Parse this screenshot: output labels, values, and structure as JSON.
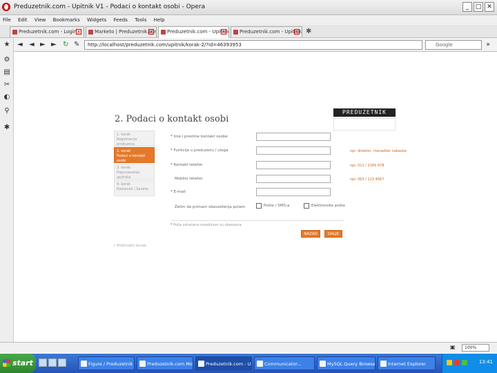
{
  "window": {
    "title": "Preduzetnik.com - Upitnik V1 - Podaci o kontakt osobi - Opera",
    "minimize": "_",
    "maximize": "□",
    "close": "✕"
  },
  "menu": [
    "File",
    "Edit",
    "View",
    "Bookmarks",
    "Widgets",
    "Feeds",
    "Tools",
    "Help"
  ],
  "tabs": [
    {
      "label": "Preduzetnik.com - Login",
      "active": false
    },
    {
      "label": "Marketo | Preduzetnik.com",
      "active": false
    },
    {
      "label": "Preduzetnik.com - Upitnik",
      "active": true
    },
    {
      "label": "Preduzetnik.com - Upitnik",
      "active": false
    }
  ],
  "addressbar": {
    "url": "http://localhost/preduzetnik.com/upitnik/korak-2/?id=46393953",
    "search_placeholder": "Google"
  },
  "page": {
    "heading": "2. Podaci o kontakt osobi",
    "logo": "PREDUZETNIK",
    "steps": [
      {
        "title": "1. korak",
        "subtitle": "Registracija preduzeća",
        "active": false
      },
      {
        "title": "2. korak",
        "subtitle": "Podaci o kontakt osobi",
        "active": true
      },
      {
        "title": "3. korak",
        "subtitle": "Popunjavanje upitnika",
        "active": false
      },
      {
        "title": "4. korak",
        "subtitle": "Nastavak / Savete",
        "active": false
      }
    ],
    "form": {
      "fields": [
        {
          "label": "Ime i prezime kontakt osobe",
          "required": true,
          "hint": ""
        },
        {
          "label": "Funkcija u preduzeću / uloga",
          "required": true,
          "hint": "npr. direktor, menadžer nabavke"
        },
        {
          "label": "Kontakt telefon",
          "required": true,
          "hint": "npr. 011 / 2345 678"
        },
        {
          "label": "Mobilni telefon",
          "required": false,
          "hint": "npr. 063 / 123 4567"
        },
        {
          "label": "E-mail",
          "required": true,
          "hint": ""
        }
      ],
      "contact_pref_label": "Želim da primam obaveštenja putem",
      "checkbox_1": "Pošte / SMS-a",
      "checkbox_2": "Elektronske pošte",
      "footnote": "Polja označena zvezdicom su obavezna",
      "back_button": "NAZAD",
      "next_button": "DALJE",
      "prev_link": "« Prethodni korak"
    }
  },
  "statusbar": {
    "zoom": "100%"
  },
  "taskbar": {
    "start": "start",
    "tasks": [
      {
        "label": "Figure / Preduzetnik",
        "active": false
      },
      {
        "label": "Preduzetnik.com Mock...",
        "active": false
      },
      {
        "label": "Preduzetnik.com - Up...",
        "active": true
      },
      {
        "label": "Communicator...",
        "active": false
      },
      {
        "label": "MySQL Query Browser",
        "active": false
      },
      {
        "label": "Internet Explorer",
        "active": false
      }
    ],
    "clock": "13:41"
  }
}
